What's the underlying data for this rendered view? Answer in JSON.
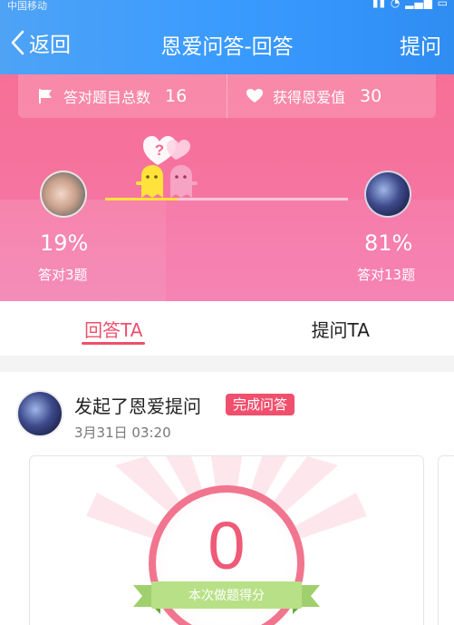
{
  "status_bar": {
    "carrier": "中国移动",
    "right_text": "",
    "clock": ""
  },
  "header": {
    "back_label": "返回",
    "title": "恩爱问答-回答",
    "ask_label": "提问"
  },
  "stats": {
    "total_correct_label": "答对题目总数",
    "total_correct_value": "16",
    "love_points_label": "获得恩爱值",
    "love_points_value": "30",
    "left_percent": "19%",
    "left_count": "答对3题",
    "right_percent": "81%",
    "right_count": "答对13题",
    "left_share": 0.19,
    "right_share": 0.81,
    "bubble_mark": "?"
  },
  "tabs": [
    {
      "label": "回答TA",
      "active": true
    },
    {
      "label": "提问TA",
      "active": false
    }
  ],
  "feed": {
    "title": "发起了恩爱提问",
    "badge": "完成问答",
    "time": "3月31日 03:20",
    "score_value": "0",
    "score_label": "本次做题得分"
  },
  "colors": {
    "header_blue": "#3a9bff",
    "hero_pink": "#f574a1",
    "accent_red": "#ef4f6c",
    "progress_yellow": "#ffe23c"
  },
  "icons": [
    "back-chevron-icon",
    "flag-icon",
    "heart-icon",
    "heart-bubble-icon",
    "yellow-mascot-icon",
    "pink-mascot-icon"
  ]
}
